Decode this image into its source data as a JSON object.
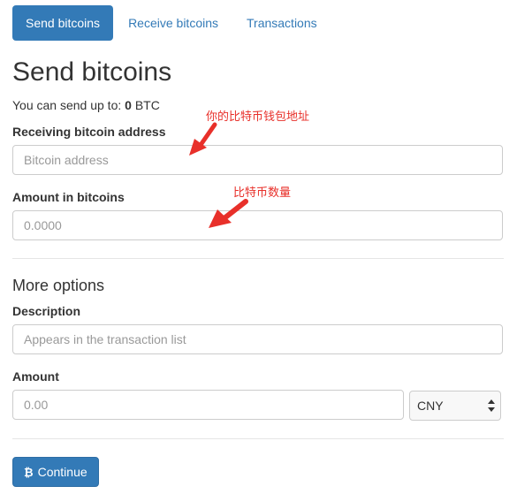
{
  "tabs": [
    {
      "label": "Send bitcoins",
      "active": true
    },
    {
      "label": "Receive bitcoins",
      "active": false
    },
    {
      "label": "Transactions",
      "active": false
    }
  ],
  "page_title": "Send bitcoins",
  "limit": {
    "prefix": "You can send up to: ",
    "amount": "0",
    "unit": " BTC"
  },
  "address": {
    "label": "Receiving bitcoin address",
    "placeholder": "Bitcoin address",
    "annotation": "你的比特币钱包地址"
  },
  "amount_btc": {
    "label": "Amount in bitcoins",
    "placeholder": "0.0000",
    "annotation": "比特币数量"
  },
  "more_options": {
    "title": "More options",
    "description": {
      "label": "Description",
      "placeholder": "Appears in the transaction list"
    },
    "amount": {
      "label": "Amount",
      "placeholder": "0.00",
      "currency": "CNY"
    }
  },
  "continue_button": {
    "icon": "bitcoin-icon",
    "icon_glyph": "₿",
    "label": "Continue"
  },
  "colors": {
    "primary": "#337ab7",
    "annotation": "#e8302a",
    "text": "#333333",
    "placeholder": "#999999",
    "border": "#cccccc"
  }
}
